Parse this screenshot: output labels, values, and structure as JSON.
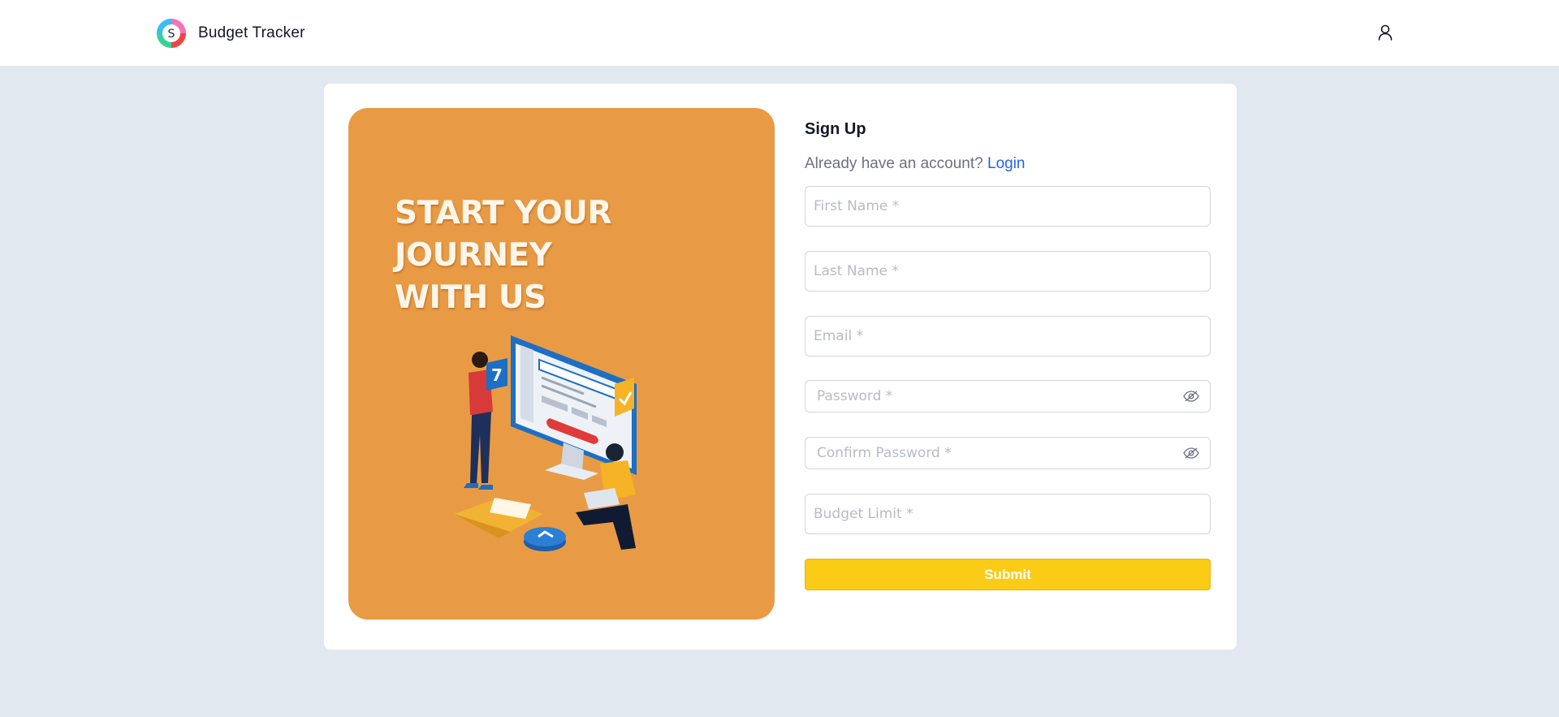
{
  "header": {
    "brand_name": "Budget Tracker",
    "logo_letter": "S",
    "user_icon": "user-icon"
  },
  "hero": {
    "title_line1": "START YOUR JOURNEY",
    "title_line2": "WITH US",
    "illustration_icon": "online-form-illustration",
    "illustration_digit": "7",
    "background_color": "#e89b44"
  },
  "signup": {
    "title": "Sign Up",
    "login_prompt": "Already have an account?",
    "login_link": "Login",
    "fields": {
      "first_name_placeholder": "First Name *",
      "last_name_placeholder": "Last Name *",
      "email_placeholder": "Email *",
      "password_placeholder": "Password *",
      "confirm_password_placeholder": "Confirm Password *",
      "budget_limit_placeholder": "Budget Limit *"
    },
    "password_toggle_icon": "eye-off-icon",
    "submit_label": "Submit",
    "accent_color": "#facc15",
    "link_color": "#2563eb"
  }
}
